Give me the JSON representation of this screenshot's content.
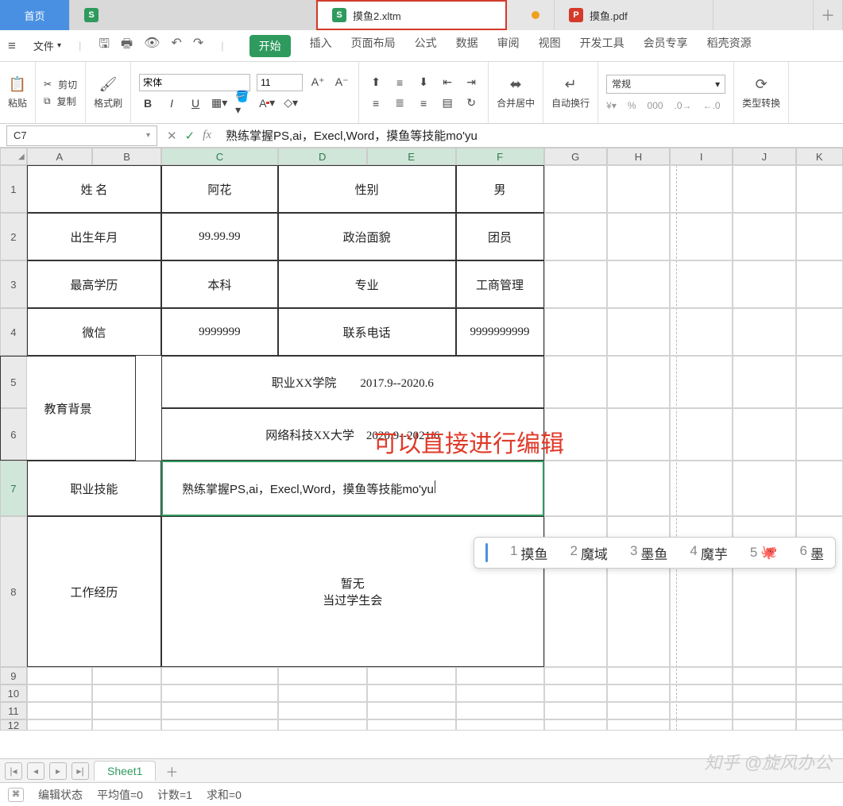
{
  "tabs": {
    "home": "首页",
    "active_file": "摸鱼2.xltm",
    "pdf_file": "摸鱼.pdf"
  },
  "menubar": {
    "file": "文件",
    "qat": {
      "save": "💾",
      "print": "🖨",
      "preview": "🔍",
      "undo": "↶",
      "redo": "↷"
    },
    "ribtabs": {
      "start": "开始",
      "insert": "插入",
      "layout": "页面布局",
      "formula": "公式",
      "data": "数据",
      "review": "审阅",
      "view": "视图",
      "dev": "开发工具",
      "member": "会员专享",
      "resources": "稻壳资源"
    }
  },
  "ribbon": {
    "paste": "粘贴",
    "cut": "剪切",
    "copy": "复制",
    "brush": "格式刷",
    "font_name": "宋体",
    "font_size": "11",
    "merge": "合并居中",
    "wrap": "自动换行",
    "numfmt": "常规",
    "convert": "类型转换"
  },
  "namebox": "C7",
  "formula_text": "熟练掌握PS,ai，Execl,Word，摸鱼等技能mo'yu",
  "columns": [
    "A",
    "B",
    "C",
    "D",
    "E",
    "F",
    "G",
    "H",
    "I",
    "J",
    "K"
  ],
  "rows_visible": [
    "1",
    "2",
    "3",
    "4",
    "5",
    "6",
    "7",
    "8",
    "9",
    "10",
    "11",
    "12"
  ],
  "sheet": {
    "r1": {
      "ab": "姓 名",
      "c": "阿花",
      "de": "性别",
      "f": "男"
    },
    "r2": {
      "ab": "出生年月",
      "c": "99.99.99",
      "de": "政治面貌",
      "f": "团员"
    },
    "r3": {
      "ab": "最高学历",
      "c": "本科",
      "de": "专业",
      "f": "工商管理"
    },
    "r4": {
      "ab": "微信",
      "c": "9999999",
      "de": "联系电话",
      "f": "9999999999"
    },
    "r56_label": "教育背景",
    "r5": "职业XX学院　　2017.9--2020.6",
    "r6": "网络科技XX大学　2020.9--2021.6",
    "r7_label": "职业技能",
    "r7_text": "熟练掌握PS,ai，Execl,Word，摸鱼等技能mo'yu",
    "r8_label": "工作经历",
    "r8_text_l1": "暂无",
    "r8_text_l2": "当过学生会"
  },
  "annotation": "可以直接进行编辑",
  "ime": {
    "c1n": "1",
    "c1": "摸鱼",
    "c2n": "2",
    "c2": "魔域",
    "c3n": "3",
    "c3": "墨鱼",
    "c4n": "4",
    "c4": "魔芋",
    "c5n": "5",
    "c5": "🐙",
    "c6n": "6",
    "c6": "墨"
  },
  "sheet_tabs": {
    "sheet1": "Sheet1"
  },
  "statusbar": {
    "mode": "编辑状态",
    "avg": "平均值=0",
    "count": "计数=1",
    "sum": "求和=0"
  },
  "watermark": "知乎 @旋风办公"
}
